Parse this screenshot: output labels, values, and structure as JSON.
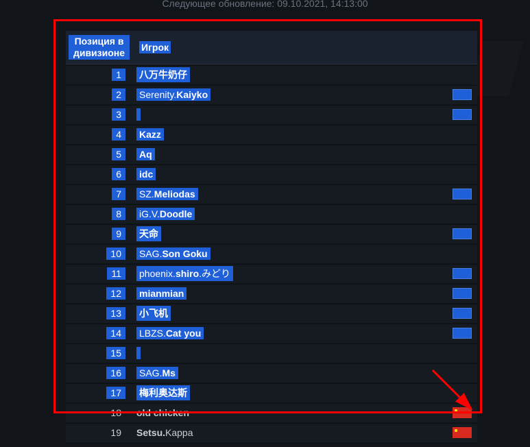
{
  "update_text": "Следующее обновление: 09.10.2021, 14:13:00",
  "headers": {
    "position": "Позиция в дивизионе",
    "player": "Игрок"
  },
  "rows": [
    {
      "rank": "1",
      "hl": true,
      "prefix": "",
      "name": "八万牛奶仔",
      "flag": null
    },
    {
      "rank": "2",
      "hl": true,
      "prefix": "Serenity.",
      "name": "Kaiyko",
      "flag": "eu"
    },
    {
      "rank": "3",
      "hl": true,
      "prefix": "",
      "name": "",
      "flag": "eu",
      "empty": true
    },
    {
      "rank": "4",
      "hl": true,
      "prefix": "",
      "name": "Kazz",
      "flag": null
    },
    {
      "rank": "5",
      "hl": true,
      "prefix": "",
      "name": "Aq",
      "flag": null
    },
    {
      "rank": "6",
      "hl": true,
      "prefix": "",
      "name": "idc",
      "flag": null
    },
    {
      "rank": "7",
      "hl": true,
      "prefix": "SZ.",
      "name": "Meliodas",
      "flag": "eu"
    },
    {
      "rank": "8",
      "hl": true,
      "prefix": "iG.V.",
      "name": "Doodle",
      "flag": null
    },
    {
      "rank": "9",
      "hl": true,
      "prefix": "",
      "name": "天命",
      "flag": "eu"
    },
    {
      "rank": "10",
      "hl": true,
      "prefix": "SAG.",
      "name": "Son Goku",
      "flag": null
    },
    {
      "rank": "11",
      "hl": true,
      "prefix": "phoenix.",
      "name": "shiro",
      "suffix": ".みどり",
      "flag": "eu"
    },
    {
      "rank": "12",
      "hl": true,
      "prefix": "",
      "name": "mianmian",
      "flag": "eu"
    },
    {
      "rank": "13",
      "hl": true,
      "prefix": "",
      "name": "小飞机",
      "flag": "eu"
    },
    {
      "rank": "14",
      "hl": true,
      "prefix": "LBZS.",
      "name": "Cat you",
      "flag": "eu"
    },
    {
      "rank": "15",
      "hl": true,
      "prefix": "",
      "name": "",
      "flag": null,
      "empty": true
    },
    {
      "rank": "16",
      "hl": true,
      "prefix": "SAG.",
      "name": "Ms",
      "flag": null
    },
    {
      "rank": "17",
      "hl": true,
      "prefix": "",
      "name": "梅利奥达斯",
      "flag": null
    },
    {
      "rank": "18",
      "hl": false,
      "prefix": "",
      "name": "old chicken",
      "flag": "cn"
    },
    {
      "rank": "19",
      "hl": false,
      "prefix": "Setsu.",
      "name": "",
      "suffix": "Kappa",
      "flag": "cn",
      "boldprefix": true
    }
  ]
}
